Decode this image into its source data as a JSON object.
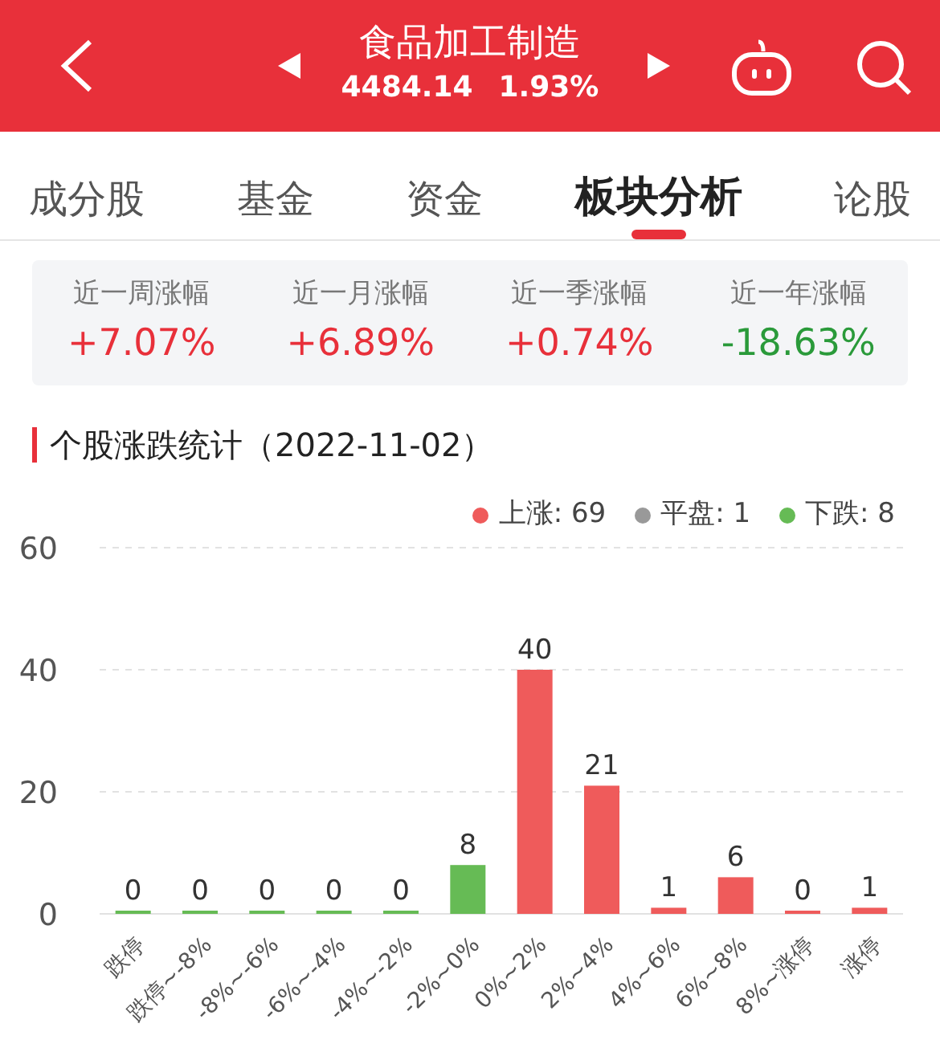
{
  "header": {
    "title": "食品加工制造",
    "price": "4484.14",
    "change": "1.93%"
  },
  "tabs": [
    {
      "label": "成分股",
      "selected": false
    },
    {
      "label": "基金",
      "selected": false
    },
    {
      "label": "资金",
      "selected": false
    },
    {
      "label": "板块分析",
      "selected": true
    },
    {
      "label": "论股",
      "selected": false
    }
  ],
  "stats": [
    {
      "label": "近一周涨幅",
      "value": "+7.07%",
      "color": "#e8303a"
    },
    {
      "label": "近一月涨幅",
      "value": "+6.89%",
      "color": "#e8303a"
    },
    {
      "label": "近一季涨幅",
      "value": "+0.74%",
      "color": "#e8303a"
    },
    {
      "label": "近一年涨幅",
      "value": "-18.63%",
      "color": "#2a9a3a"
    }
  ],
  "section_title": "个股涨跌统计（2022-11-02）",
  "legend": [
    {
      "label": "上涨: 69",
      "color": "#ef5b5b"
    },
    {
      "label": "平盘: 1",
      "color": "#999999"
    },
    {
      "label": "下跌: 8",
      "color": "#66bb55"
    }
  ],
  "chart_data": {
    "type": "bar",
    "categories": [
      "跌停",
      "跌停~-8%",
      "-8%~-6%",
      "-6%~-4%",
      "-4%~-2%",
      "-2%~0%",
      "0%~2%",
      "2%~4%",
      "4%~6%",
      "6%~8%",
      "8%~涨停",
      "涨停"
    ],
    "series": [
      {
        "color": "#66bb55",
        "values": [
          0,
          0,
          0,
          0,
          0,
          8,
          null,
          null,
          null,
          null,
          null,
          null
        ]
      },
      {
        "color": "#ef5b5b",
        "values": [
          null,
          null,
          null,
          null,
          null,
          null,
          40,
          21,
          1,
          6,
          0,
          1
        ]
      }
    ],
    "stacked": true,
    "ylim": [
      0,
      60
    ],
    "yticks": [
      0,
      20,
      40,
      60
    ],
    "data_labels": true
  }
}
